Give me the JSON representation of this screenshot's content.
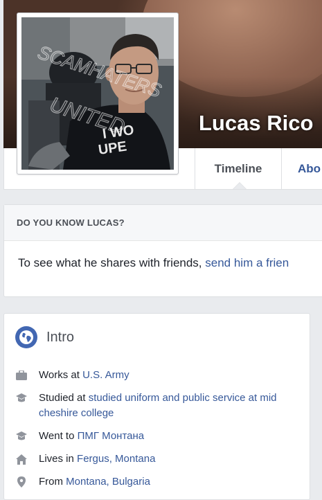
{
  "profile": {
    "name": "Lucas Rico",
    "watermark": [
      "SCAMHATERS",
      "UNITED"
    ]
  },
  "nav": {
    "tabs": [
      {
        "label": "Timeline",
        "active": true
      },
      {
        "label": "Abo",
        "active": false
      }
    ]
  },
  "know": {
    "title": "DO YOU KNOW LUCAS?",
    "text": "To see what he shares with friends, ",
    "link": "send him a frien"
  },
  "intro": {
    "title": "Intro",
    "items": [
      {
        "icon": "briefcase-icon",
        "prefix": "Works at ",
        "link": "U.S. Army"
      },
      {
        "icon": "graduation-icon",
        "prefix": "Studied at ",
        "link": "studied uniform and public service at mid cheshire college"
      },
      {
        "icon": "graduation-icon",
        "prefix": "Went to ",
        "link": "ПМГ Монтана"
      },
      {
        "icon": "house-icon",
        "prefix": "Lives in ",
        "link": "Fergus, Montana"
      },
      {
        "icon": "location-pin-icon",
        "prefix": "From ",
        "link": "Montana, Bulgaria"
      }
    ]
  },
  "colors": {
    "link": "#365899",
    "page_bg": "#e9ebee",
    "globe": "#4267b2"
  }
}
